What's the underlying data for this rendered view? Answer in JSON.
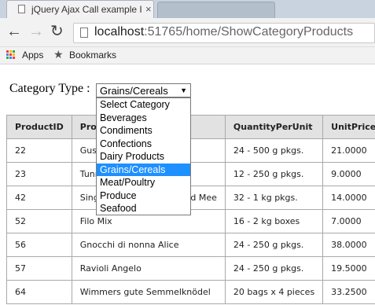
{
  "browser": {
    "tab_title": "jQuery Ajax Call example I",
    "tab_close": "×",
    "url_host": "localhost",
    "url_path": ":51765/home/ShowCategoryProducts",
    "bookmarks": [
      "Apps",
      "Bookmarks"
    ]
  },
  "form": {
    "label": "Category Type :",
    "selected": "Grains/Cereals",
    "options": [
      "Select Category",
      "Beverages",
      "Condiments",
      "Confections",
      "Dairy Products",
      "Grains/Cereals",
      "Meat/Poultry",
      "Produce",
      "Seafood"
    ]
  },
  "table": {
    "headers": [
      "ProductID",
      "ProductName",
      "QuantityPerUnit",
      "UnitPrice"
    ],
    "rows": [
      [
        "22",
        "Gustaf's Knäckebröd",
        "24 - 500 g pkgs.",
        "21.0000"
      ],
      [
        "23",
        "Tunnbröd",
        "12 - 250 g pkgs.",
        "9.0000"
      ],
      [
        "42",
        "Singaporean Hokkien Fried Mee",
        "32 - 1 kg pkgs.",
        "14.0000"
      ],
      [
        "52",
        "Filo Mix",
        "16 - 2 kg boxes",
        "7.0000"
      ],
      [
        "56",
        "Gnocchi di nonna Alice",
        "24 - 250 g pkgs.",
        "38.0000"
      ],
      [
        "57",
        "Ravioli Angelo",
        "24 - 250 g pkgs.",
        "19.5000"
      ],
      [
        "64",
        "Wimmers gute Semmelknödel",
        "20 bags x 4 pieces",
        "33.2500"
      ]
    ]
  },
  "colors": {
    "highlight": "#1e90ff",
    "header_bg": "#e2e2e2"
  }
}
